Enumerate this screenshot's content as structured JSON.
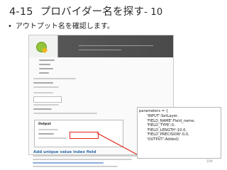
{
  "slide": {
    "number": "4-15",
    "title": "プロバイダー名を探す",
    "title_suffix": "- 10",
    "bullet_symbol": "•",
    "bullet_text": "アウトプット名を確認します。"
  },
  "screenshot": {
    "output_label": "Output",
    "section_heading": "Add unique value index field"
  },
  "callout": {
    "header": "parameters = {",
    "lines": [
      "'INPUT':SetLayer,",
      "'FIELD_NAME':Field_name,",
      "'FIELD_TYPE':0,",
      "'FIELD_LENGTH':10,0,",
      "'FIELD_PRECISION':0,0,",
      "'OUTPUT':Added}"
    ]
  },
  "page_number": "109",
  "colors": {
    "highlight": "#e2231a",
    "heading_blue": "#2d6aa8",
    "qgis_green": "#93c43a",
    "qgis_yellow": "#eeb51b"
  }
}
